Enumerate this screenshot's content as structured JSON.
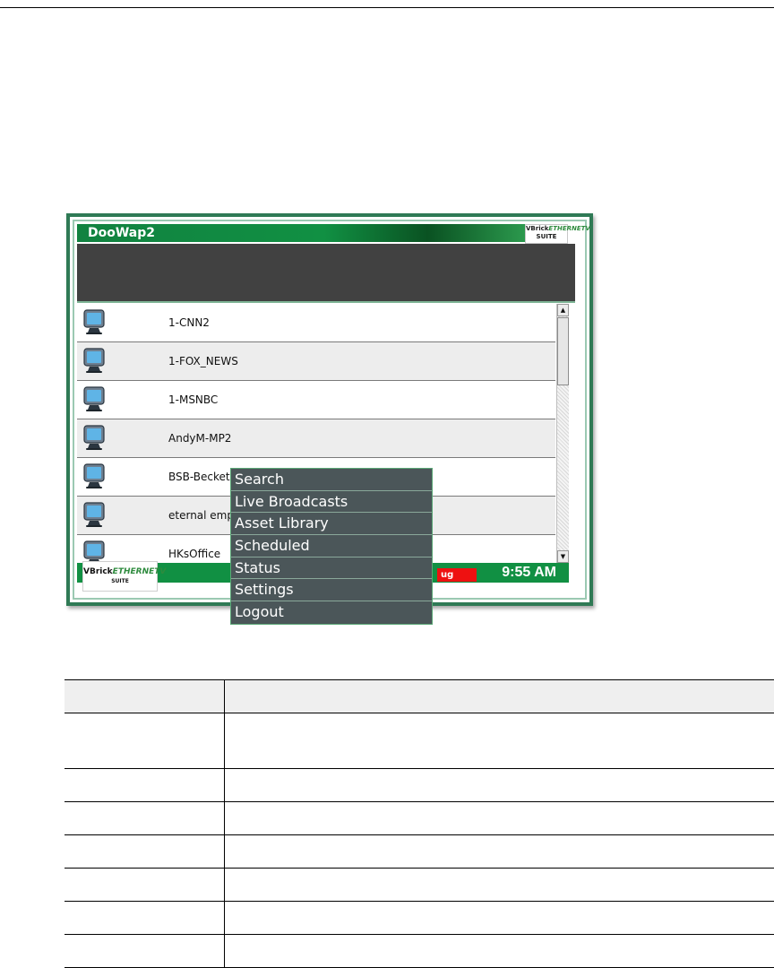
{
  "window": {
    "title": "DooWap2"
  },
  "brand": {
    "name": "VBrick",
    "accent": "ETHERNETV",
    "suffix": "SUITE"
  },
  "channels": [
    {
      "name": "1-CNN2"
    },
    {
      "name": "1-FOX_NEWS"
    },
    {
      "name": "1-MSNBC"
    },
    {
      "name": "AndyM-MP2"
    },
    {
      "name": "BSB-Becket"
    },
    {
      "name": "eternal emp"
    },
    {
      "name": "HKsOffice"
    }
  ],
  "status": {
    "alert_text": "ug",
    "time": "9:55 AM"
  },
  "menu": {
    "items": [
      {
        "label": "Search"
      },
      {
        "label": "Live Broadcasts"
      },
      {
        "label": "Asset Library"
      },
      {
        "label": "Scheduled"
      },
      {
        "label": "Status"
      },
      {
        "label": "Settings"
      },
      {
        "label": "Logout"
      }
    ]
  },
  "colors": {
    "title_green": "#119043",
    "banner_dark": "#414141",
    "menu_bg": "#4b5659",
    "alert_red": "#ee1111"
  },
  "icons": {
    "channel": "tv-monitor-icon",
    "scroll_up": "arrow-up-icon",
    "scroll_down": "arrow-down-icon"
  }
}
